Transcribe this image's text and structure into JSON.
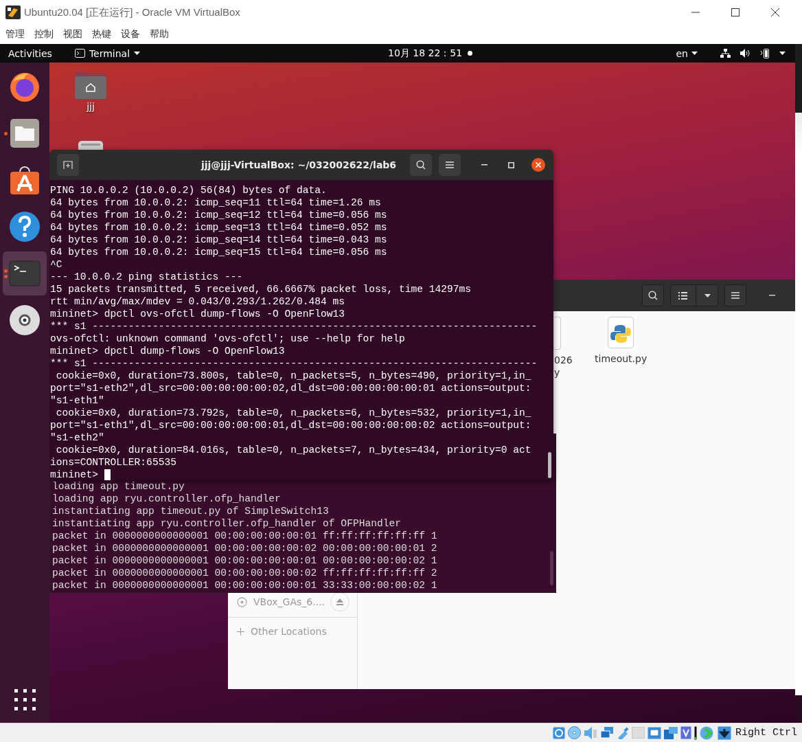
{
  "host_window": {
    "title": "Ubuntu20.04 [正在运行] - Oracle VM VirtualBox",
    "menu": [
      "管理",
      "控制",
      "视图",
      "热键",
      "设备",
      "帮助"
    ]
  },
  "top_bar": {
    "activities": "Activities",
    "app_menu": "Terminal",
    "clock": "10月 18  22：51",
    "language": "en"
  },
  "dock": [
    {
      "kind": "firefox",
      "running": false,
      "multiple_windows": false,
      "selected": false
    },
    {
      "kind": "files",
      "running": true,
      "multiple_windows": false,
      "selected": false
    },
    {
      "kind": "software",
      "running": false,
      "multiple_windows": false,
      "selected": false
    },
    {
      "kind": "help",
      "running": false,
      "multiple_windows": false,
      "selected": false
    },
    {
      "kind": "terminal",
      "running": true,
      "multiple_windows": true,
      "selected": true
    },
    {
      "kind": "disc",
      "running": false,
      "multiple_windows": false,
      "selected": false
    }
  ],
  "desktop_icons": [
    {
      "kind": "home",
      "label": "jjj"
    },
    {
      "kind": "drive"
    }
  ],
  "files_window": {
    "sidebar": [
      {
        "kind": "disc",
        "label": "VBox_GAs_6...."
      },
      {
        "kind": "other",
        "label": "Other Locations"
      }
    ],
    "files": [
      {
        "kind": "file",
        "label_lines": [
          "026",
          "y"
        ]
      },
      {
        "kind": "python",
        "label_lines": [
          "timeout.py"
        ]
      }
    ]
  },
  "back_terminal": {
    "lines": [
      "loading app timeout.py",
      "loading app ryu.controller.ofp_handler",
      "instantiating app timeout.py of SimpleSwitch13",
      "instantiating app ryu.controller.ofp_handler of OFPHandler",
      "packet in 0000000000000001 00:00:00:00:00:01 ff:ff:ff:ff:ff:ff 1",
      "packet in 0000000000000001 00:00:00:00:00:02 00:00:00:00:00:01 2",
      "packet in 0000000000000001 00:00:00:00:00:01 00:00:00:00:00:02 1",
      "packet in 0000000000000001 00:00:00:00:00:02 ff:ff:ff:ff:ff:ff 2",
      "packet in 0000000000000001 00:00:00:00:00:01 33:33:00:00:00:02 1"
    ]
  },
  "terminal": {
    "title": "jjj@jjj-VirtualBox: ~/032002622/lab6",
    "lines": [
      "PING 10.0.0.2 (10.0.0.2) 56(84) bytes of data.",
      "64 bytes from 10.0.0.2: icmp_seq=11 ttl=64 time=1.26 ms",
      "64 bytes from 10.0.0.2: icmp_seq=12 ttl=64 time=0.056 ms",
      "64 bytes from 10.0.0.2: icmp_seq=13 ttl=64 time=0.052 ms",
      "64 bytes from 10.0.0.2: icmp_seq=14 ttl=64 time=0.043 ms",
      "64 bytes from 10.0.0.2: icmp_seq=15 ttl=64 time=0.056 ms",
      "^C",
      "--- 10.0.0.2 ping statistics ---",
      "15 packets transmitted, 5 received, 66.6667% packet loss, time 14297ms",
      "rtt min/avg/max/mdev = 0.043/0.293/1.262/0.484 ms",
      "mininet> dpctl ovs-ofctl dump-flows -O OpenFlow13",
      "*** s1 --------------------------------------------------------------------------",
      "ovs-ofctl: unknown command 'ovs-ofctl'; use --help for help",
      "mininet> dpctl dump-flows -O OpenFlow13",
      "*** s1 --------------------------------------------------------------------------",
      " cookie=0x0, duration=73.800s, table=0, n_packets=5, n_bytes=490, priority=1,in_",
      "port=\"s1-eth2\",dl_src=00:00:00:00:00:02,dl_dst=00:00:00:00:00:01 actions=output:",
      "\"s1-eth1\"",
      " cookie=0x0, duration=73.792s, table=0, n_packets=6, n_bytes=532, priority=1,in_",
      "port=\"s1-eth1\",dl_src=00:00:00:00:00:01,dl_dst=00:00:00:00:00:02 actions=output:",
      "\"s1-eth2\"",
      " cookie=0x0, duration=84.016s, table=0, n_packets=7, n_bytes=434, priority=0 act",
      "ions=CONTROLLER:65535"
    ],
    "prompt": "mininet> "
  },
  "status_bar": {
    "host_key": "Right Ctrl"
  }
}
